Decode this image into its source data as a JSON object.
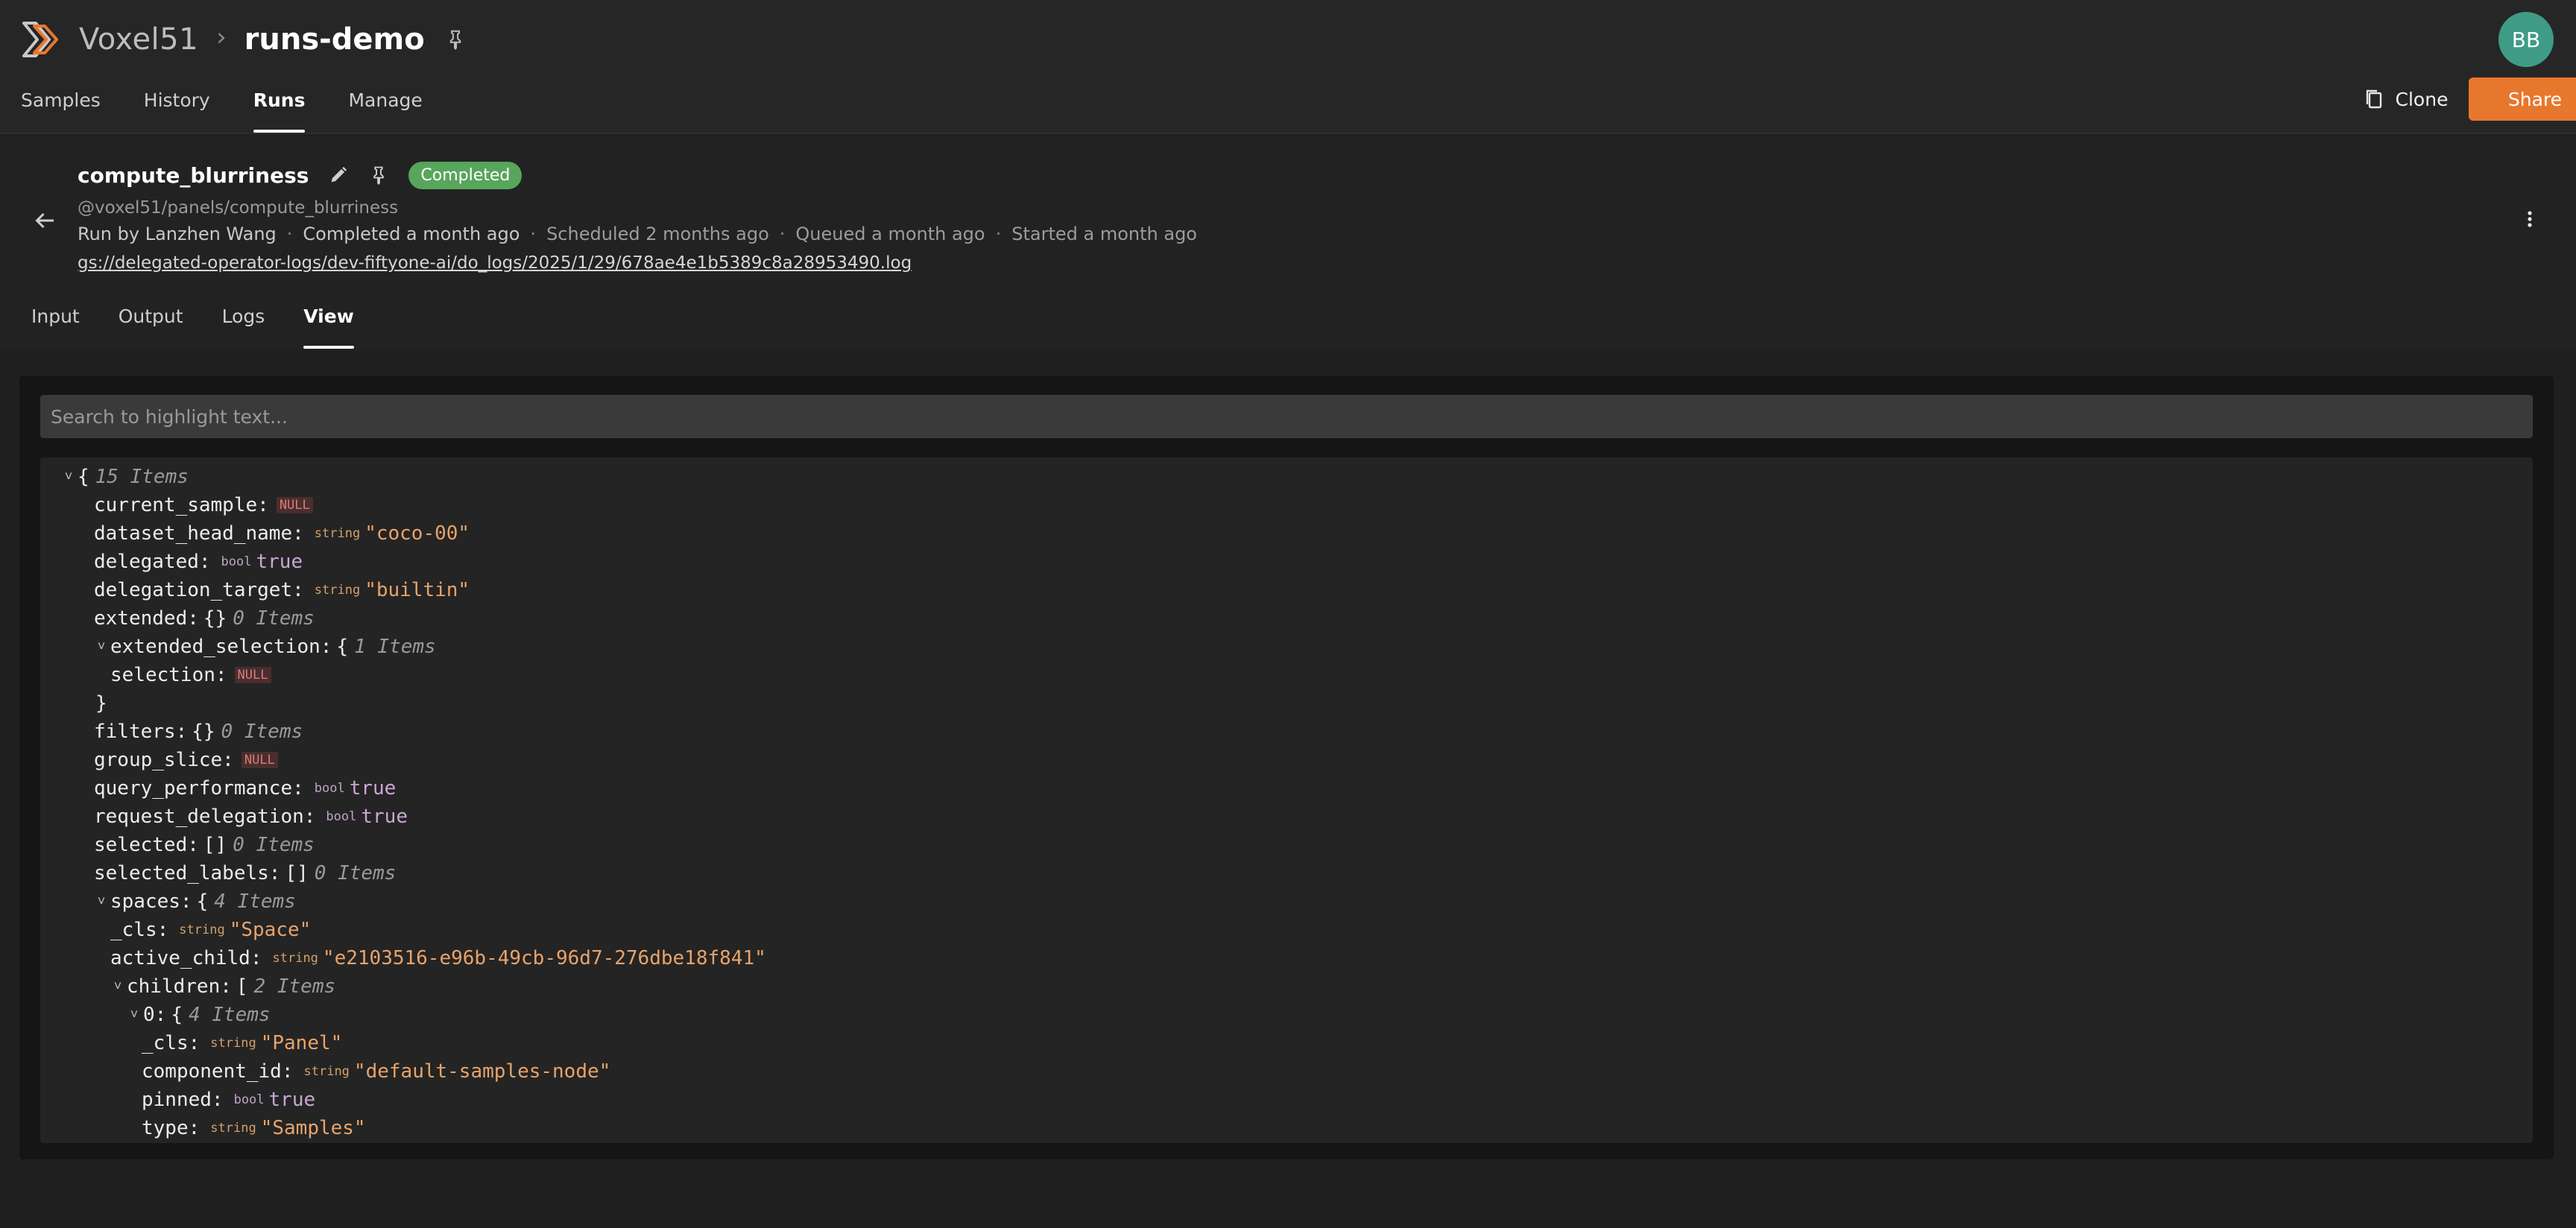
{
  "header": {
    "brand": "Voxel51",
    "separator": "›",
    "dataset": "runs-demo",
    "avatar_initials": "BB",
    "nav_tabs": [
      "Samples",
      "History",
      "Runs",
      "Manage"
    ],
    "active_nav": "Runs",
    "clone_label": "Clone",
    "share_label": "Share",
    "accent_color": "#e8772e"
  },
  "run": {
    "name": "compute_blurriness",
    "status": "Completed",
    "status_color": "#58a55c",
    "operator_uri": "@voxel51/panels/compute_blurriness",
    "run_by": "Run by Lanzhen Wang",
    "completed": "Completed a month ago",
    "scheduled": "Scheduled 2 months ago",
    "queued": "Queued a month ago",
    "started": "Started a month ago",
    "log_path": "gs://delegated-operator-logs/dev-fiftyone-ai/do_logs/2025/1/29/678ae4e1b5389c8a28953490.log",
    "tabs": [
      "Input",
      "Output",
      "Logs",
      "View"
    ],
    "active_tab": "View"
  },
  "viewer": {
    "search_placeholder": "Search to highlight text...",
    "root_count": "15 Items",
    "lines": {
      "current_sample": "current_sample:",
      "dataset_head_name": "dataset_head_name:",
      "dataset_head_name_val": "\"coco-00\"",
      "delegated": "delegated:",
      "delegated_val": "true",
      "delegation_target": "delegation_target:",
      "delegation_target_val": "\"builtin\"",
      "extended": "extended:",
      "extended_count": "0 Items",
      "extended_selection": "extended_selection:",
      "extended_selection_count": "1 Items",
      "selection": "selection:",
      "filters": "filters:",
      "filters_count": "0 Items",
      "group_slice": "group_slice:",
      "query_performance": "query_performance:",
      "query_performance_val": "true",
      "request_delegation": "request_delegation:",
      "request_delegation_val": "true",
      "selected": "selected:",
      "selected_count": "0 Items",
      "selected_labels": "selected_labels:",
      "selected_labels_count": "0 Items",
      "spaces": "spaces:",
      "spaces_count": "4 Items",
      "spaces_cls": "_cls:",
      "spaces_cls_val": "\"Space\"",
      "active_child": "active_child:",
      "active_child_val": "\"e2103516-e96b-49cb-96d7-276dbe18f841\"",
      "children": "children:",
      "children_count": "2 Items",
      "child0": "0:",
      "child0_count": "4 Items",
      "child0_cls": "_cls:",
      "child0_cls_val": "\"Panel\"",
      "component_id": "component_id:",
      "component_id_val": "\"default-samples-node\"",
      "pinned": "pinned:",
      "pinned_val": "true",
      "type": "type:",
      "type_val": "\"Samples\""
    },
    "type_labels": {
      "string": "string",
      "bool": "bool",
      "null": "NULL"
    }
  }
}
